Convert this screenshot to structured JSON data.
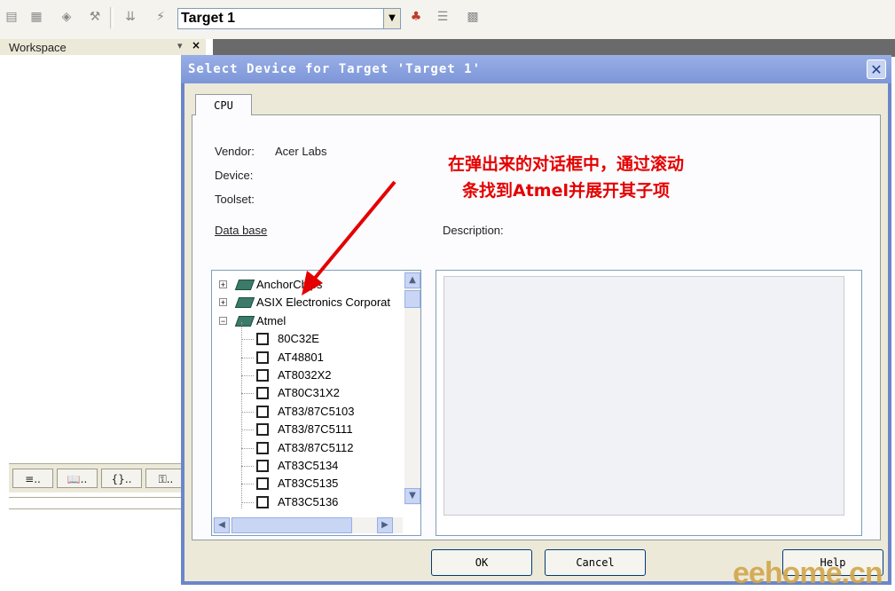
{
  "toolbar": {
    "target_select": {
      "value": "Target 1"
    },
    "icons": [
      "batch-build-icon",
      "batch-setup-icon",
      "rebuild-icon",
      "clean-icon",
      "download-icon",
      "load-icon",
      "target-options-icon",
      "manage-components-icon",
      "select-packs-icon",
      "file-extensions-icon"
    ]
  },
  "workspace": {
    "title": "Workspace",
    "tabs": [
      "≡..",
      "📖..",
      "{}..",
      "⚿.."
    ]
  },
  "dialog": {
    "title": "Select Device for Target 'Target 1'",
    "tab_cpu": "CPU",
    "vendor_label": "Vendor:",
    "vendor_value": "Acer Labs",
    "device_label": "Device:",
    "toolset_label": "Toolset:",
    "database_label": "Data base",
    "description_label": "Description:",
    "tree": [
      {
        "label": "AnchorChips",
        "type": "vendor",
        "expanded": false
      },
      {
        "label": "ASIX Electronics Corporat",
        "type": "vendor",
        "expanded": false
      },
      {
        "label": "Atmel",
        "type": "vendor",
        "expanded": true
      },
      {
        "label": "80C32E",
        "type": "device"
      },
      {
        "label": "AT48801",
        "type": "device"
      },
      {
        "label": "AT8032X2",
        "type": "device"
      },
      {
        "label": "AT80C31X2",
        "type": "device"
      },
      {
        "label": "AT83/87C5103",
        "type": "device"
      },
      {
        "label": "AT83/87C5111",
        "type": "device"
      },
      {
        "label": "AT83/87C5112",
        "type": "device"
      },
      {
        "label": "AT83C5134",
        "type": "device"
      },
      {
        "label": "AT83C5135",
        "type": "device"
      },
      {
        "label": "AT83C5136",
        "type": "device"
      }
    ],
    "ok_label": "OK",
    "cancel_label": "Cancel",
    "help_label": "Help"
  },
  "annotation": {
    "line1": "在弹出来的对话框中，通过滚动",
    "line2": "条找到Atmel并展开其子项"
  },
  "watermark": "eehome.cn",
  "colors": {
    "title_bar": "#7d96d8",
    "annotation": "#e40000",
    "watermark": "#d2a64a"
  }
}
